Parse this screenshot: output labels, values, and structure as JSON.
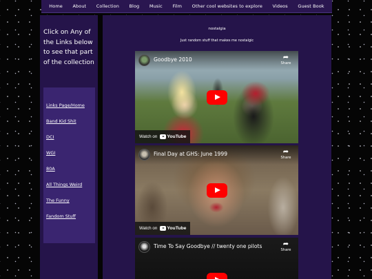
{
  "nav": {
    "items": [
      "Home",
      "About",
      "Collection",
      "Blog",
      "Music",
      "Film",
      "Other cool websites to explore",
      "Videos",
      "Guest Book"
    ]
  },
  "sidebar": {
    "intro": "Click on Any of the Links below to see that part of the collection",
    "links": [
      "Links Page/Home",
      "Band Kid Shit",
      "DCI",
      "WGI",
      "80A",
      "All Things Weird",
      "The Funny",
      "Fandom Stuff"
    ]
  },
  "main": {
    "heading": "nostalgia",
    "subheading": "Just random stuff that makes me nostalgic"
  },
  "videos": [
    {
      "title": "Goodbye 2010",
      "share_label": "Share",
      "watch_label": "Watch on",
      "platform": "YouTube"
    },
    {
      "title": "Final Day at GHS: June 1999",
      "share_label": "Share",
      "watch_label": "Watch on",
      "platform": "YouTube"
    },
    {
      "title": "Time To Say Goodbye // twenty one pilots",
      "share_label": "Share",
      "watch_label": "Watch on",
      "platform": "YouTube"
    }
  ],
  "colors": {
    "page_background": "#050505",
    "panel": "#25144a",
    "link_box": "#3a2570",
    "nav_bar": "#2a1650",
    "youtube_red": "#ff0000"
  }
}
